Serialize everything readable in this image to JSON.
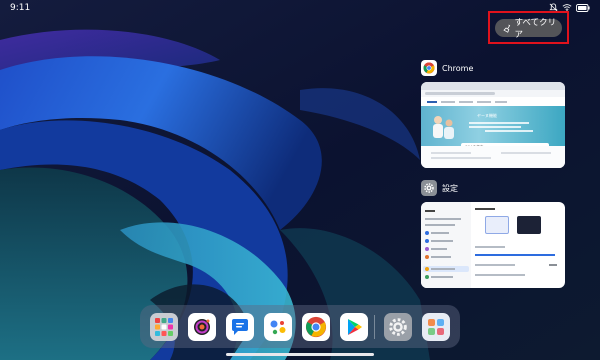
{
  "status_bar": {
    "time": "9:11",
    "icons": [
      "silent-icon",
      "wifi-icon",
      "battery-icon"
    ]
  },
  "recents": {
    "clear_all_label": "すべてクリア",
    "clear_all_icon": "broom-icon",
    "highlight_color": "#e0121c",
    "apps": [
      {
        "title": "Chrome",
        "icon": "chrome-icon",
        "preview": {
          "hero_headline": "ヤーヌ機能",
          "search_placeholder": "Q&Aを検索"
        }
      },
      {
        "title": "設定",
        "icon": "settings-gear-icon",
        "preview": {}
      }
    ]
  },
  "dock": {
    "apps": [
      {
        "name": "app-folder",
        "icon": "app-folder-icon"
      },
      {
        "name": "camera",
        "icon": "camera-icon"
      },
      {
        "name": "messages",
        "icon": "messages-icon"
      },
      {
        "name": "assistant",
        "icon": "assistant-icon"
      },
      {
        "name": "chrome",
        "icon": "chrome-icon"
      },
      {
        "name": "play-store",
        "icon": "play-store-icon"
      },
      {
        "name": "settings",
        "icon": "settings-gear-icon"
      },
      {
        "name": "app-library",
        "icon": "app-library-icon"
      }
    ]
  }
}
